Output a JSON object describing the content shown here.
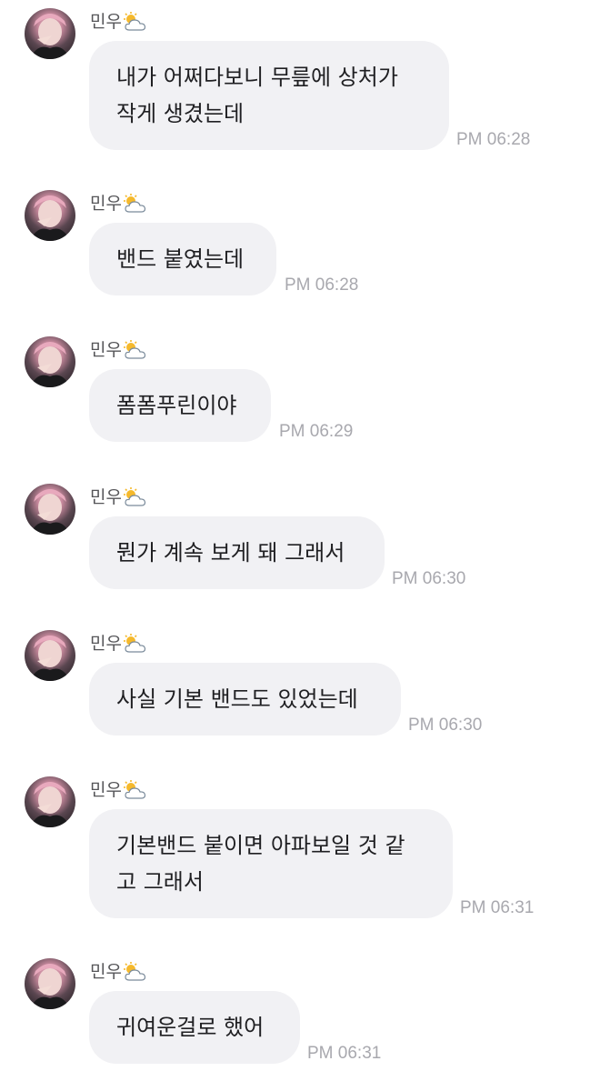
{
  "sender_name": "민우",
  "sender_emoji_icon": "sun-behind-cloud-icon",
  "messages": [
    {
      "text": "내가 어쩌다보니 무릎에 상처가\n작게 생겼는데",
      "time": "PM 06:28"
    },
    {
      "text": "밴드 붙였는데",
      "time": "PM 06:28"
    },
    {
      "text": "폼폼푸린이야",
      "time": "PM 06:29"
    },
    {
      "text": "뭔가 계속 보게 돼 그래서",
      "time": "PM 06:30"
    },
    {
      "text": "사실 기본 밴드도 있었는데",
      "time": "PM 06:30"
    },
    {
      "text": "기본밴드 붙이면 아파보일 것 같\n고 그래서",
      "time": "PM 06:31"
    },
    {
      "text": "귀여운걸로 했어",
      "time": "PM 06:31"
    }
  ]
}
